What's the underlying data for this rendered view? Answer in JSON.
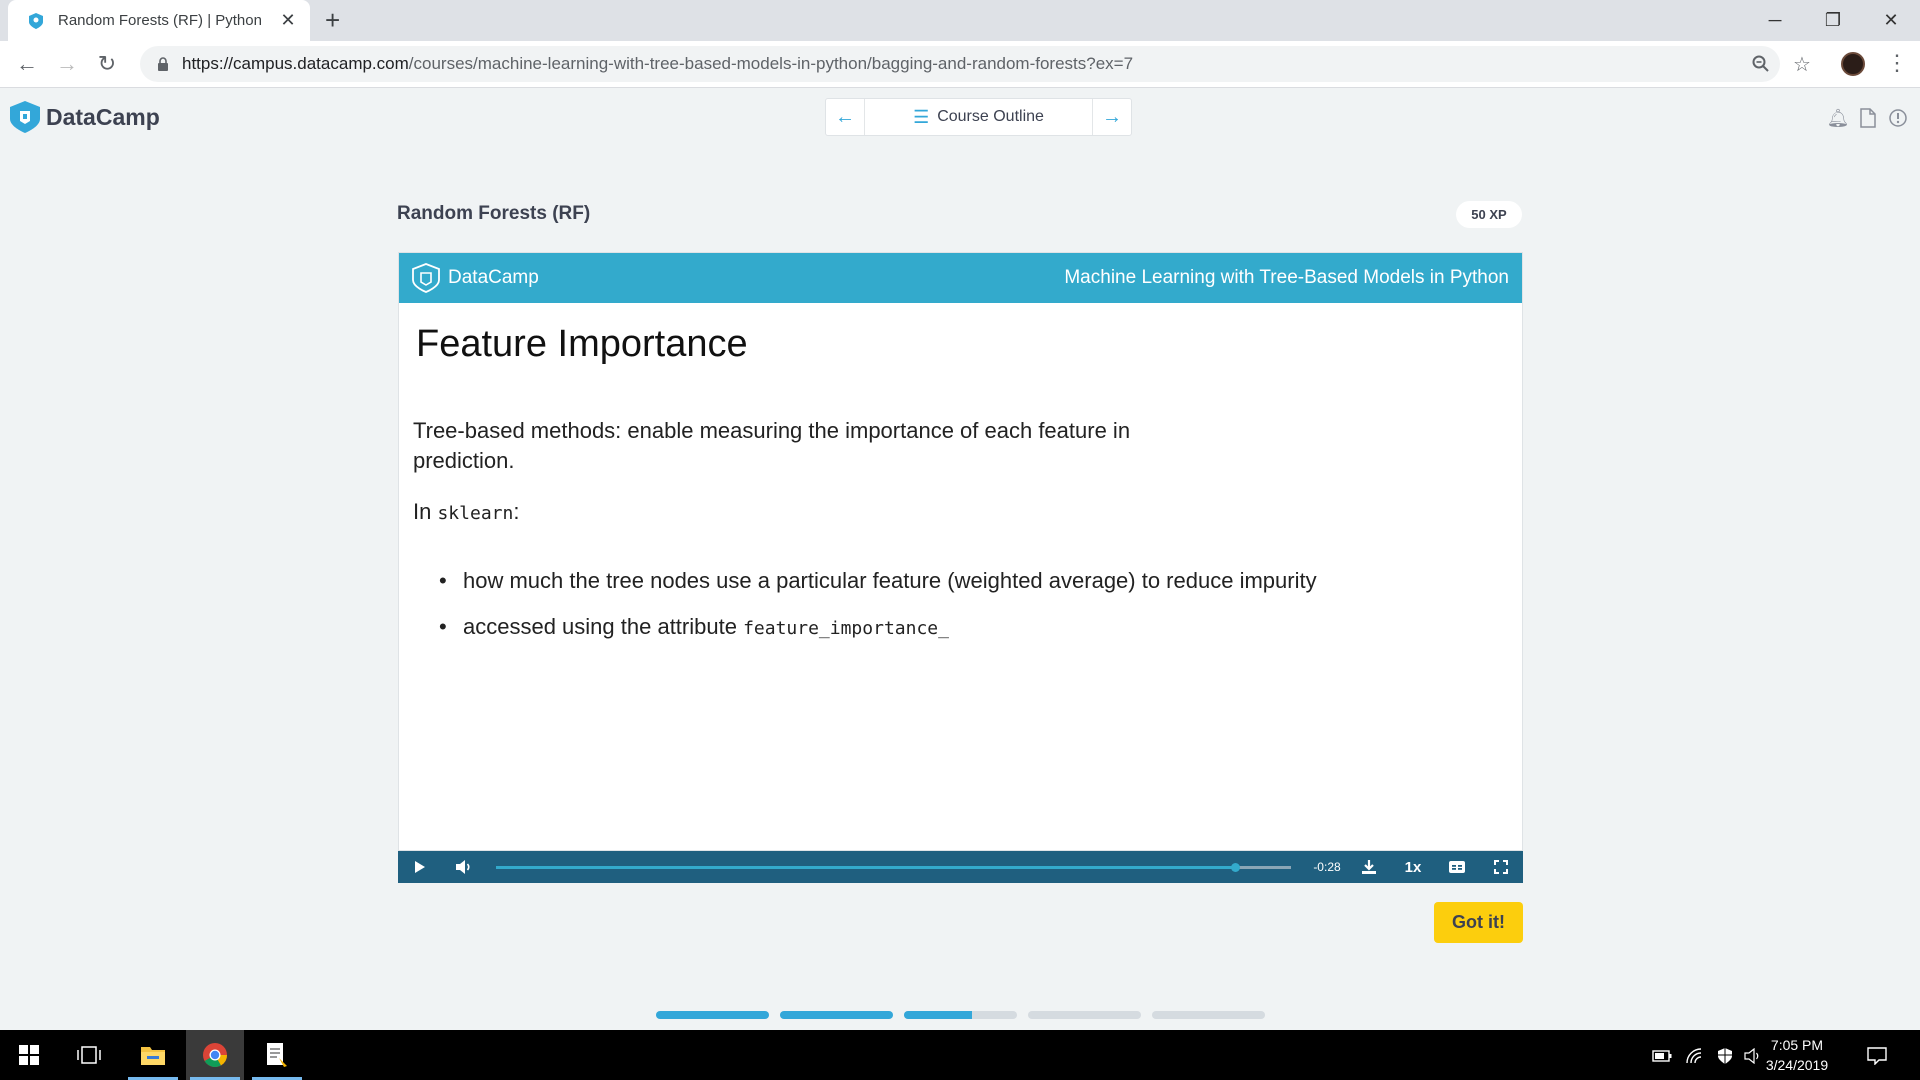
{
  "browser": {
    "tab_title": "Random Forests (RF) | Python",
    "url_host": "https://campus.datacamp.com",
    "url_path": "/courses/machine-learning-with-tree-based-models-in-python/bagging-and-random-forests?ex=7"
  },
  "header": {
    "logo_text": "DataCamp",
    "course_outline_label": "Course Outline"
  },
  "exercise": {
    "title": "Random Forests (RF)",
    "xp": "50 XP"
  },
  "slide": {
    "brand": "DataCamp",
    "course_name": "Machine Learning with Tree-Based Models in Python",
    "heading": "Feature Importance",
    "intro": "Tree-based methods: enable measuring the importance of each feature in prediction.",
    "in_label": "In ",
    "in_code": "sklearn",
    "in_suffix": ":",
    "bullet1": "how much the tree nodes use a particular feature (weighted average) to reduce impurity",
    "bullet2_text": "accessed using the attribute ",
    "bullet2_code": "feature_importance_"
  },
  "player": {
    "time_remaining": "-0:28",
    "speed": "1x",
    "progress_fraction": 0.93
  },
  "actions": {
    "got_it_label": "Got it!"
  },
  "exercise_steps": [
    1.0,
    1.0,
    0.6,
    0.0,
    0.0
  ],
  "taskbar": {
    "time": "7:05 PM",
    "date": "3/24/2019"
  },
  "colors": {
    "accent": "#33aacc",
    "player_bar": "#1f5f7f",
    "cta": "#fcce0d"
  }
}
